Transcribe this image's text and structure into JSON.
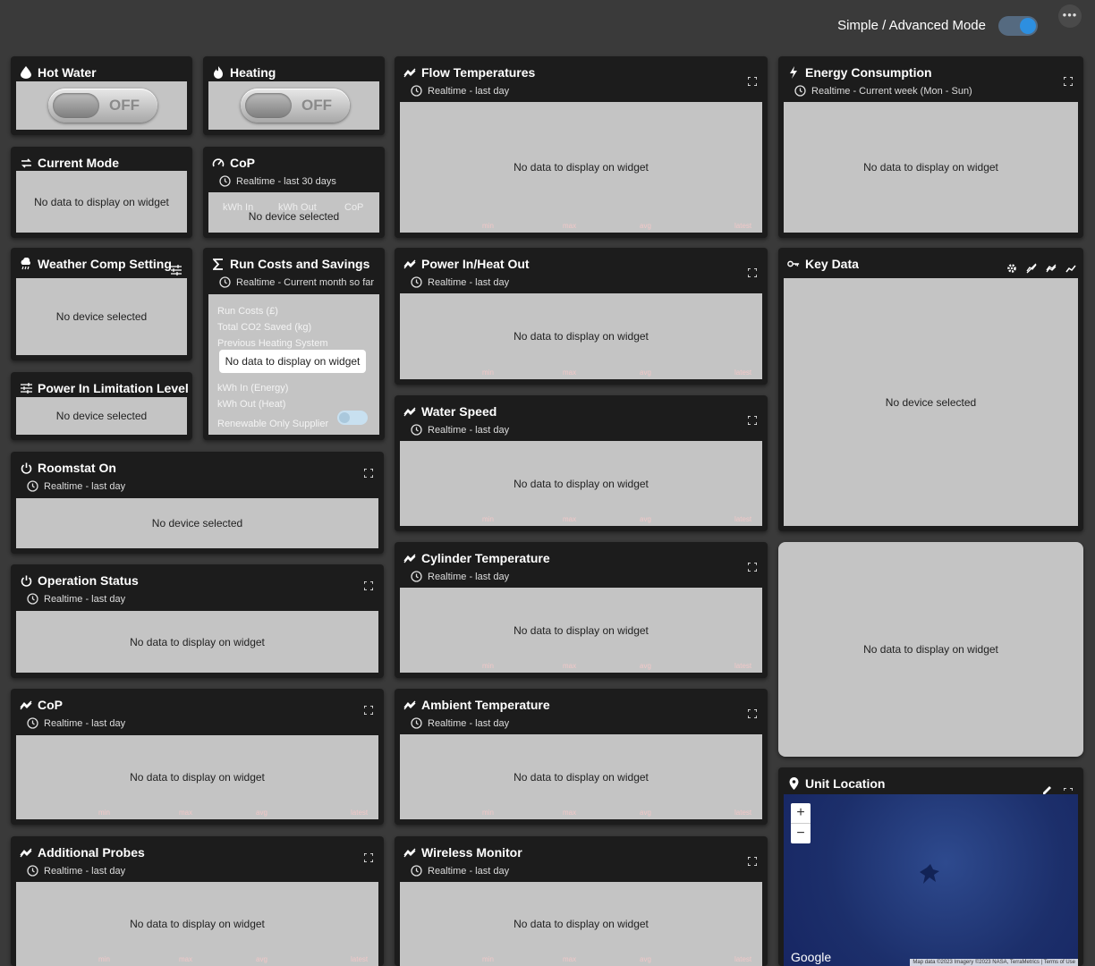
{
  "topbar": {
    "mode_label": "Simple / Advanced Mode",
    "more": "•••",
    "accent": "#2d8fe0"
  },
  "common": {
    "no_data": "No data to display on widget",
    "no_device": "No device selected",
    "rt_last_day": "Realtime - last day",
    "legend": {
      "min": "min",
      "max": "max",
      "avg": "avg",
      "latest": "latest"
    }
  },
  "hot_water": {
    "title": "Hot Water",
    "state": "OFF"
  },
  "heating": {
    "title": "Heating",
    "state": "OFF"
  },
  "current_mode": {
    "title": "Current Mode"
  },
  "cop_small": {
    "title": "CoP",
    "subtitle": "Realtime - last 30 days",
    "col1": "kWh In",
    "col2": "kWh Out",
    "col3": "CoP"
  },
  "weather_comp": {
    "title": "Weather Comp Setting"
  },
  "run_costs": {
    "title": "Run Costs and Savings",
    "subtitle": "Realtime - Current month so far",
    "items": [
      "Run Costs (£)",
      "Total CO2 Saved (kg)",
      "Previous Heating System",
      "",
      "kWh In (Energy)",
      "kWh Out (Heat)",
      "Renewable Only Supplier"
    ]
  },
  "power_limit": {
    "title": "Power In Limitation Level"
  },
  "roomstat": {
    "title": "Roomstat On"
  },
  "operation_status": {
    "title": "Operation Status"
  },
  "cop_chart": {
    "title": "CoP"
  },
  "additional_probes": {
    "title": "Additional Probes"
  },
  "flow_temps": {
    "title": "Flow Temperatures"
  },
  "power_in_heat_out": {
    "title": "Power In/Heat Out"
  },
  "water_speed": {
    "title": "Water Speed"
  },
  "cylinder_temp": {
    "title": "Cylinder Temperature"
  },
  "ambient_temp": {
    "title": "Ambient Temperature"
  },
  "wireless_monitor": {
    "title": "Wireless Monitor"
  },
  "energy_consumption": {
    "title": "Energy Consumption",
    "subtitle": "Realtime - Current week (Mon - Sun)"
  },
  "key_data": {
    "title": "Key Data"
  },
  "unit_location": {
    "title": "Unit Location",
    "zoom_in": "+",
    "zoom_out": "−",
    "google": "Google",
    "attribution": "Map data ©2023 Imagery ©2023 NASA, TerraMetrics | Terms of Use"
  }
}
